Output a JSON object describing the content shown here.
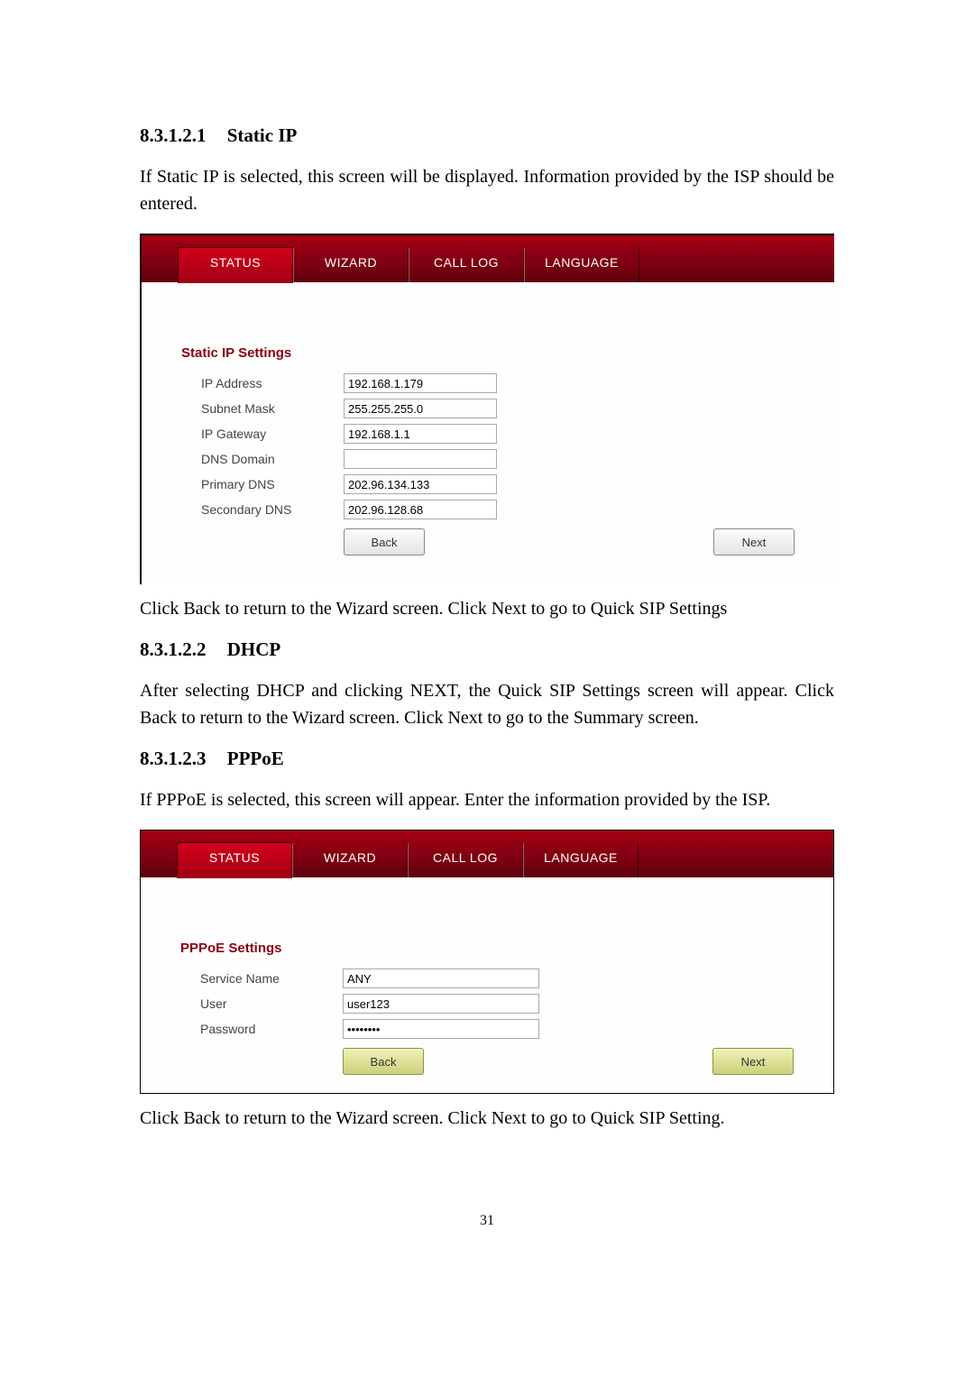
{
  "headings": {
    "h1": {
      "num": "8.3.1.2.1",
      "title": "Static IP"
    },
    "h2": {
      "num": "8.3.1.2.2",
      "title": "DHCP"
    },
    "h3": {
      "num": "8.3.1.2.3",
      "title": "PPPoE"
    }
  },
  "paragraphs": {
    "p1": "If Static IP is selected, this screen will be displayed.    Information provided by the ISP should be entered.",
    "p2": "Click Back to return to the Wizard screen.    Click Next to go to Quick SIP Settings",
    "p3": "After selecting DHCP and clicking NEXT, the Quick SIP Settings screen will appear.    Click Back to return to the Wizard screen.    Click Next to go to the Summary screen.",
    "p4": "If PPPoE is selected, this screen will appear. Enter the information provided by the ISP.",
    "p5": "Click Back to return to the Wizard screen.    Click Next to go to Quick SIP Setting."
  },
  "nav": {
    "items": [
      "STATUS",
      "WIZARD",
      "CALL LOG",
      "LANGUAGE"
    ],
    "activeIndex": 0
  },
  "staticIP": {
    "title": "Static IP Settings",
    "fields": [
      {
        "label": "IP Address",
        "value": "192.168.1.179"
      },
      {
        "label": "Subnet Mask",
        "value": "255.255.255.0"
      },
      {
        "label": "IP Gateway",
        "value": "192.168.1.1"
      },
      {
        "label": "DNS Domain",
        "value": ""
      },
      {
        "label": "Primary DNS",
        "value": "202.96.134.133"
      },
      {
        "label": "Secondary DNS",
        "value": "202.96.128.68"
      }
    ],
    "back": "Back",
    "next": "Next"
  },
  "pppoe": {
    "title": "PPPoE Settings",
    "fields": [
      {
        "label": "Service Name",
        "value": "ANY",
        "type": "text"
      },
      {
        "label": "User",
        "value": "user123",
        "type": "text"
      },
      {
        "label": "Password",
        "value": "••••••••",
        "type": "password"
      }
    ],
    "back": "Back",
    "next": "Next"
  },
  "pageNumber": "31"
}
